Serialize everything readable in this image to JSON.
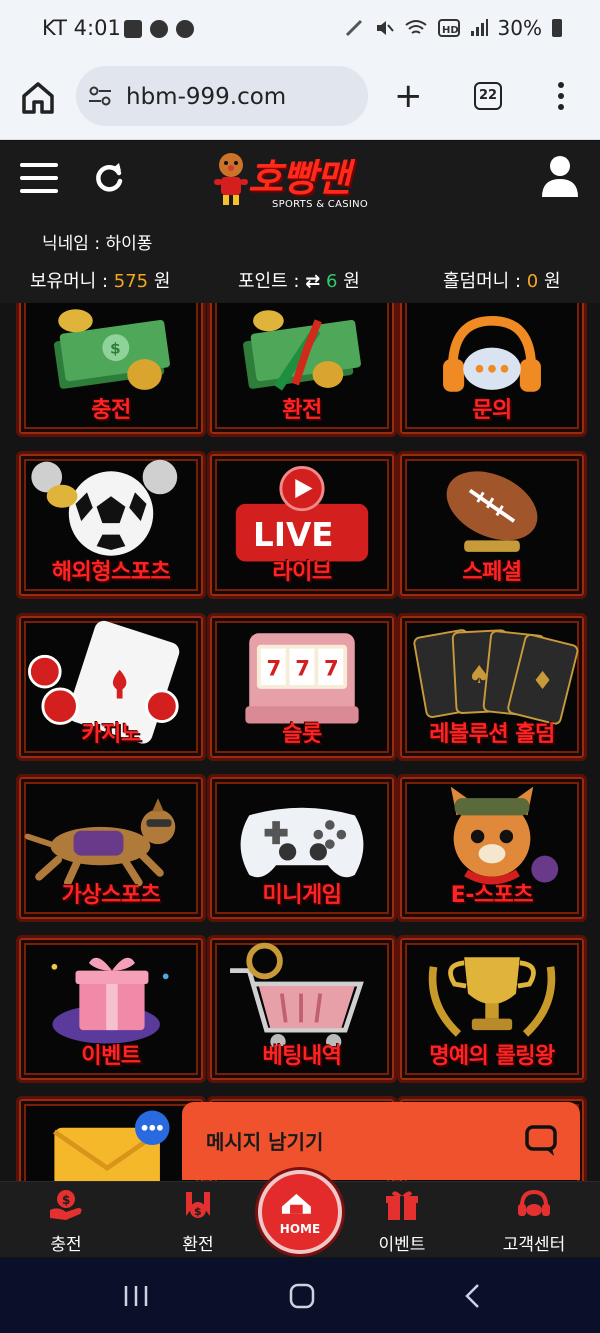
{
  "status_bar": {
    "carrier_time": "KT 4:01",
    "battery": "30%"
  },
  "browser": {
    "url": "hbm-999.com",
    "tab_count": "22"
  },
  "site": {
    "logo_text": "호빵맨",
    "logo_sub": "SPORTS & CASINO",
    "nickname": "닉네임 : 하이퐁",
    "money": {
      "hold_label": "보유머니 :",
      "hold_value": "575",
      "hold_unit": "원",
      "point_label": "포인트 :",
      "point_value": "6",
      "point_unit": "원",
      "holdem_label": "홀덤머니 :",
      "holdem_value": "0",
      "holdem_unit": "원"
    }
  },
  "grid": {
    "tiles": [
      {
        "label": "충전",
        "icon": "money-stack-icon"
      },
      {
        "label": "환전",
        "icon": "exchange-money-icon"
      },
      {
        "label": "문의",
        "icon": "headset-icon"
      },
      {
        "label": "해외형스포츠",
        "icon": "soccer-ball-icon"
      },
      {
        "label": "라이브",
        "icon": "live-icon"
      },
      {
        "label": "스페셜",
        "icon": "football-icon"
      },
      {
        "label": "카지노",
        "icon": "playing-card-icon"
      },
      {
        "label": "슬롯",
        "icon": "slot-machine-icon"
      },
      {
        "label": "레볼루션 홀덤",
        "icon": "cards-fan-icon"
      },
      {
        "label": "가상스포츠",
        "icon": "racing-dog-icon"
      },
      {
        "label": "미니게임",
        "icon": "gamepad-icon"
      },
      {
        "label": "E-스포츠",
        "icon": "fox-mascot-icon"
      },
      {
        "label": "이벤트",
        "icon": "gift-box-icon"
      },
      {
        "label": "베팅내역",
        "icon": "shopping-basket-icon"
      },
      {
        "label": "명예의 롤링왕",
        "icon": "trophy-icon"
      }
    ],
    "live_text": "LIVE"
  },
  "message_widget": {
    "text": "메시지 남기기"
  },
  "bottom_nav": {
    "charge": "충전",
    "exchange": "환전",
    "home": "HOME",
    "event": "이벤트",
    "support": "고객센터"
  },
  "colors": {
    "accent_red": "#ff2424",
    "orange": "#f5a623",
    "green": "#2ecc71",
    "widget": "#f0522e"
  }
}
